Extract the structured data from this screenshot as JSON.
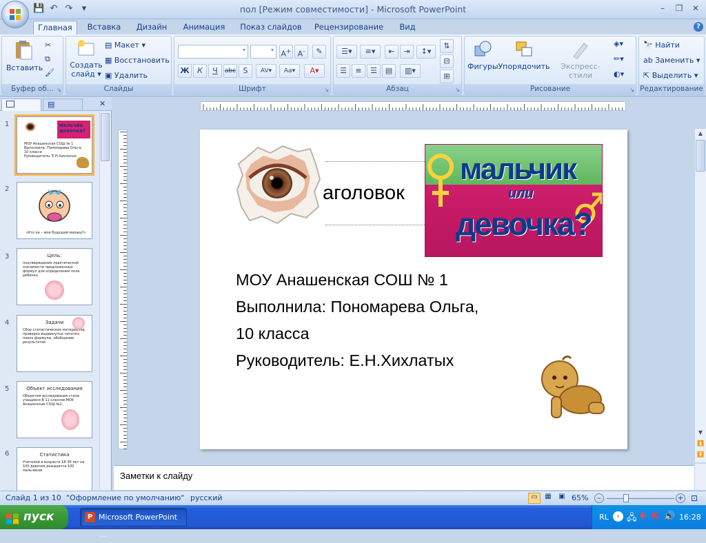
{
  "window": {
    "title": "пол [Режим совместимости] - Microsoft PowerPoint"
  },
  "tabs": [
    "Главная",
    "Вставка",
    "Дизайн",
    "Анимация",
    "Показ слайдов",
    "Рецензирование",
    "Вид"
  ],
  "ribbon": {
    "clipboard": {
      "label": "Буфер об...",
      "paste": "Вставить"
    },
    "slides": {
      "label": "Слайды",
      "create": "Создать",
      "create2": "слайд",
      "layout": "Макет",
      "reset": "Восстановить",
      "delete": "Удалить"
    },
    "font": {
      "label": "Шрифт"
    },
    "paragraph": {
      "label": "Абзац"
    },
    "drawing": {
      "label": "Рисование",
      "shapes": "Фигуры",
      "arrange": "Упорядочить",
      "styles": "Экспресс-стили"
    },
    "editing": {
      "label": "Редактирование",
      "find": "Найти",
      "replace": "Заменить",
      "select": "Выделить"
    }
  },
  "slide": {
    "title": "аголовок",
    "lines": [
      "МОУ Анашенская СОШ № 1",
      "Выполнила: Пономарева Ольга,",
      "10 класса",
      "Руководитель: Е.Н.Хихлатых"
    ],
    "banner_line1": "мальчик",
    "banner_line2": "или",
    "banner_line3": "девочка?"
  },
  "thumbnails": [
    {
      "num": "1",
      "lines": [
        "МОУ Анашенская СОШ № 1",
        "Выполнила: Пономарева Ольга,",
        "10 класса",
        "Руководитель: Е.Н.Хихлатых"
      ],
      "banner": "мальчик девочка?"
    },
    {
      "num": "2",
      "caption": "«Кто он – мои будущий малыш?»"
    },
    {
      "num": "3",
      "title": "Цель:",
      "text": "подтверждение практической значимости предложенных формул для определения пола ребенка"
    },
    {
      "num": "4",
      "title": "Задачи",
      "text": "Сбор статистических материалов; проверка выдвинутых гипотез; поиск формулы; обобщение результатов"
    },
    {
      "num": "5",
      "title": "Объект исследования",
      "text": "Объектом исследования стали учащиеся 8-11 классов МОУ Анашенская СОШ №1."
    },
    {
      "num": "6",
      "title": "Статистика",
      "text": "Учителей в возрасте 18-30 лет на 100 девочек рождается 100 мальчиков"
    }
  ],
  "notes": {
    "placeholder": "Заметки к слайду"
  },
  "status": {
    "slide": "Слайд 1 из 10",
    "theme": "\"Оформление по умолчанию\"",
    "lang": "русский",
    "zoom": "65%"
  },
  "taskbar": {
    "start": "пуск",
    "app": "Microsoft PowerPoint ...",
    "lang": "RL",
    "time": "16:28"
  },
  "colors": {
    "accent": "#f5b554",
    "banner_bg": "#d8206f",
    "banner_text": "#0f3a8a"
  }
}
